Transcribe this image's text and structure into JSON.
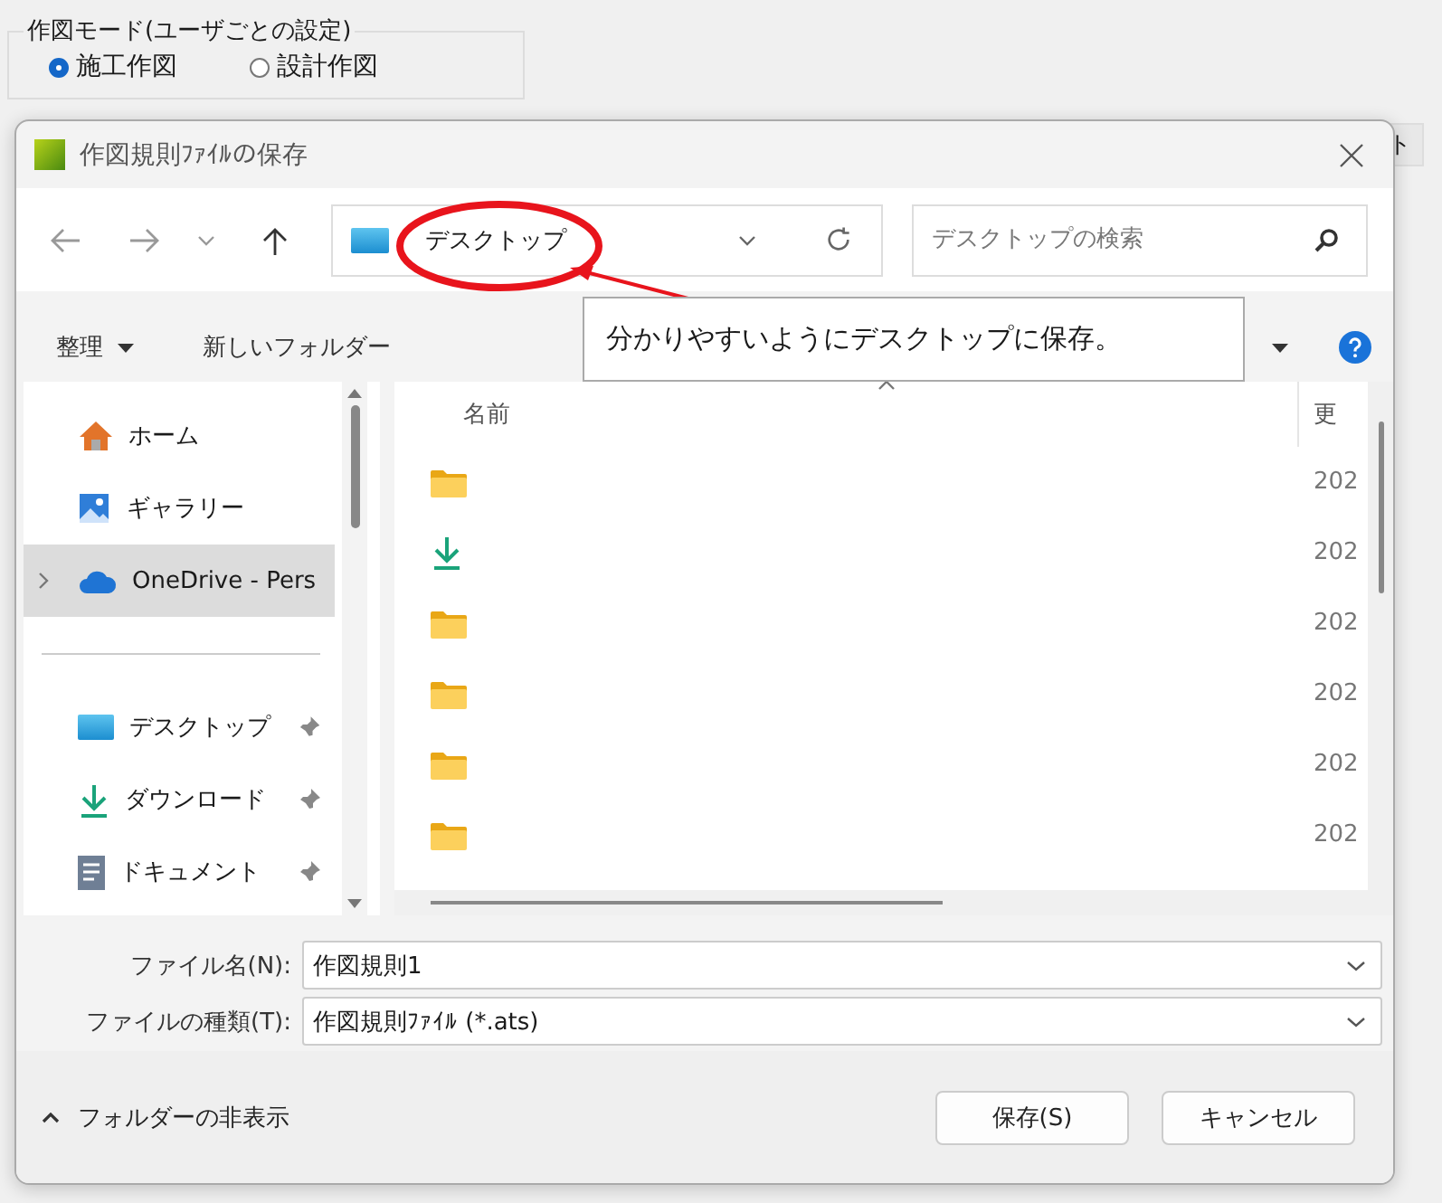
{
  "background_app": {
    "group_title": "作図モード(ユーザごとの設定)",
    "radios": [
      {
        "label": "施工作図",
        "selected": true
      },
      {
        "label": "設計作図",
        "selected": false
      }
    ],
    "column_header": "ト"
  },
  "dialog": {
    "title": "作図規則ﾌｧｲﾙの保存",
    "address": "デスクトップ",
    "search": {
      "placeholder": "デスクトップの検索"
    },
    "organize": "整理",
    "new_folder": "新しいフォルダー",
    "nav_top": [
      {
        "label": "ホーム",
        "kind": "home",
        "selected": false,
        "expandable": false
      },
      {
        "label": "ギャラリー",
        "kind": "gallery",
        "selected": false,
        "expandable": false
      },
      {
        "label": "OneDrive - Pers",
        "kind": "cloud",
        "selected": true,
        "expandable": true
      }
    ],
    "nav_pinned": [
      {
        "label": "デスクトップ",
        "kind": "desktop",
        "pinned": true
      },
      {
        "label": "ダウンロード",
        "kind": "download",
        "pinned": true
      },
      {
        "label": "ドキュメント",
        "kind": "document",
        "pinned": true
      }
    ],
    "columns": [
      "名前",
      "更"
    ],
    "files": [
      {
        "kind": "folder",
        "date": "202"
      },
      {
        "kind": "download",
        "date": "202"
      },
      {
        "kind": "folder",
        "date": "202"
      },
      {
        "kind": "folder",
        "date": "202"
      },
      {
        "kind": "folder",
        "date": "202"
      },
      {
        "kind": "folder",
        "date": "202"
      }
    ],
    "file_name_label": "ファイル名(N):",
    "file_name": "作図規則1",
    "file_type_label": "ファイルの種類(T):",
    "file_type": "作図規則ﾌｧｲﾙ (*.ats)",
    "toggle_folders": "フォルダーの非表示",
    "buttons": [
      "保存(S)",
      "キャンセル"
    ]
  },
  "callout": {
    "text": "分かりやすいようにデスクトップに保存。"
  }
}
